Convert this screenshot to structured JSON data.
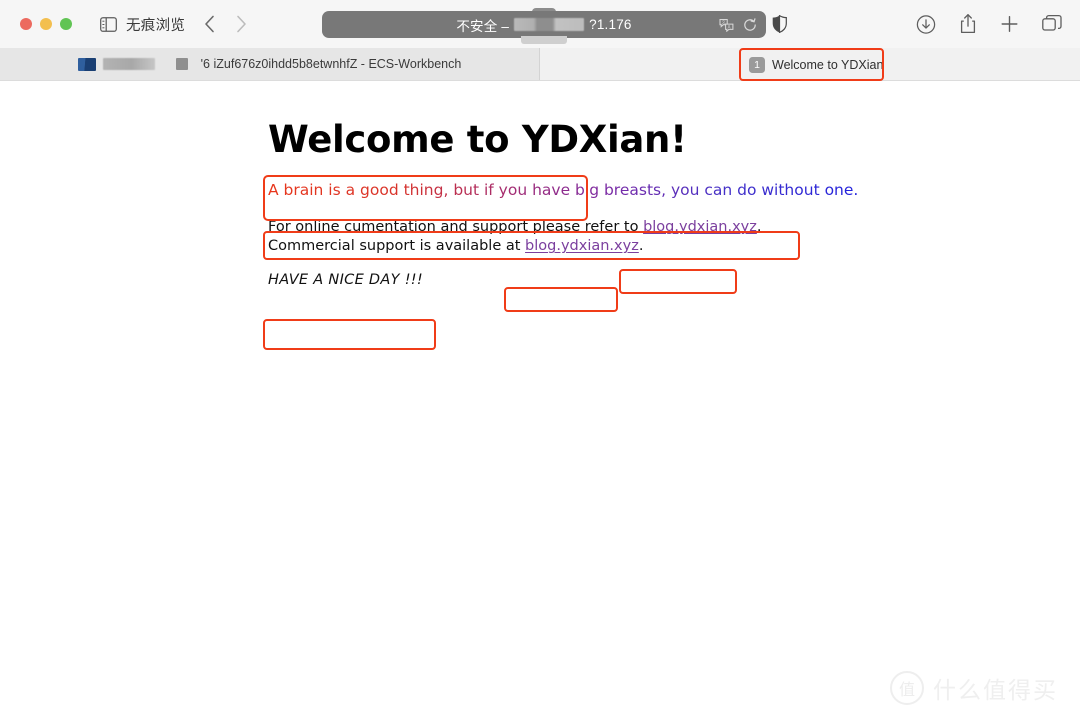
{
  "window": {
    "traffic_lights": {
      "close_color": "#ec6a5f",
      "minimize_color": "#f3bf4f",
      "maximize_color": "#61c454"
    }
  },
  "toolbar": {
    "sidebar_icon": "sidebar-icon",
    "private_browsing_label": "无痕浏览",
    "back_icon": "chevron-left-icon",
    "forward_icon": "chevron-right-icon",
    "address": {
      "security_label": "不安全 –",
      "redacted": "",
      "url_tail": "?1.176",
      "translate_icon": "translate-icon",
      "reload_icon": "reload-icon"
    },
    "shield_icon": "shield-icon",
    "download_icon": "download-icon",
    "share_icon": "share-icon",
    "new_tab_icon": "plus-icon",
    "tab_overview_icon": "tab-overview-icon"
  },
  "tabs": [
    {
      "title": "'6 iZuf676z0ihdd5b8etwnhfZ - ECS-Workbench",
      "active": false,
      "favicon": "ecs-workbench-icon"
    },
    {
      "title": "Welcome to YDXian!",
      "active": true,
      "badge": "1"
    }
  ],
  "page": {
    "heading": "Welcome to YDXian!",
    "tagline": "A brain is a good thing, but if you have big breasts, you can do without one.",
    "paragraph": {
      "line1_prefix": "For online cumentation and support please refer to ",
      "line1_link": "blog.ydxian.xyz",
      "line1_suffix": ".",
      "line2_prefix": "Commercial support is available at ",
      "line2_link": "blog.ydxian.xyz",
      "line2_suffix": "."
    },
    "closing": "HAVE A NICE DAY !!!"
  },
  "watermark": {
    "logo_char": "值",
    "text": "什么值得买"
  },
  "colors": {
    "annotation_red": "#f03c18",
    "link_purple": "#7b3f9e",
    "tagline_start": "#e8361b",
    "tagline_end": "#2222dd",
    "toolbar_bg": "#f6f6f6",
    "tabbar_bg": "#f1f1f1",
    "address_bg": "#787878"
  }
}
